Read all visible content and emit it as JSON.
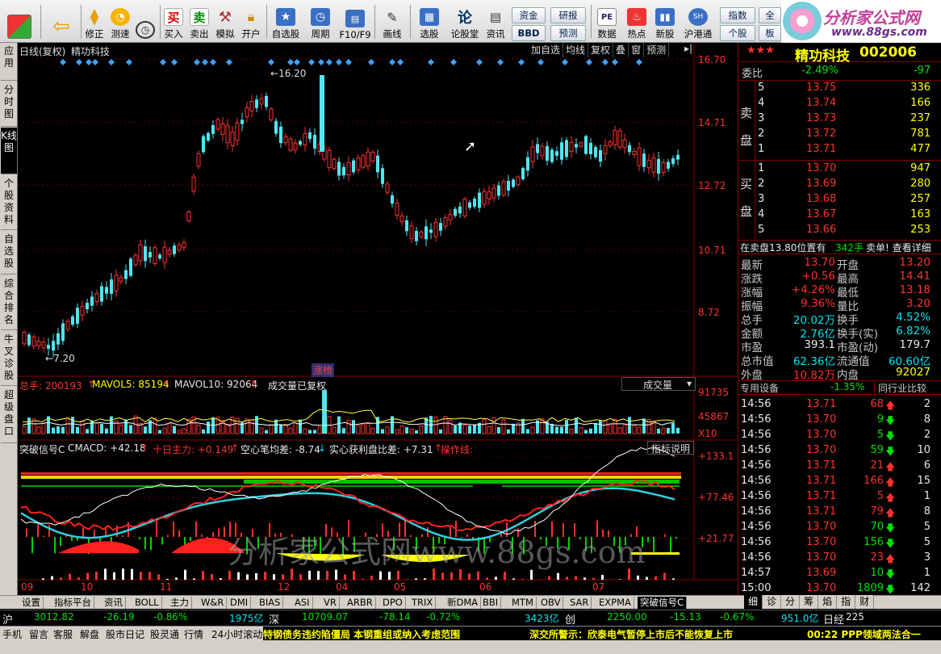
{
  "toolbar": {
    "buttons": [
      {
        "label": "修正",
        "icon": "up-down-arrow-icon"
      },
      {
        "label": "测速",
        "icon": "speed-icon"
      },
      {
        "label": "",
        "icon": "clock-icon"
      },
      {
        "label": "买入",
        "icon": "buy-icon",
        "glyph": "买"
      },
      {
        "label": "卖出",
        "icon": "sell-icon",
        "glyph": "卖"
      },
      {
        "label": "模拟",
        "icon": "hammer-icon"
      },
      {
        "label": "开户",
        "icon": "lock-icon"
      },
      {
        "label": "自选股",
        "icon": "star-icon"
      },
      {
        "label": "周期",
        "icon": "clock-cycle-icon"
      },
      {
        "label": "F10/F9",
        "icon": "f10-icon"
      },
      {
        "label": "画线",
        "icon": "pen-icon"
      },
      {
        "label": "选股",
        "icon": "select-stock-icon"
      },
      {
        "label": "论股堂",
        "icon": "forum-icon",
        "glyph": "论"
      },
      {
        "label": "资讯",
        "icon": "news-icon"
      },
      {
        "label": "数据",
        "icon": "pe-icon",
        "glyph": "PE"
      },
      {
        "label": "热点",
        "icon": "hot-icon"
      },
      {
        "label": "新股",
        "icon": "new-stock-icon"
      },
      {
        "label": "沪港通",
        "icon": "shhk-icon"
      }
    ],
    "small": [
      "资金",
      "BBD",
      "研报",
      "预测",
      "指数",
      "个股",
      "全",
      "板"
    ]
  },
  "logo": {
    "text": "分析家公式网",
    "url": "www.88gs.com"
  },
  "left_tabs": [
    "应用",
    "分时图",
    "K线图",
    "个股资料",
    "自选股",
    "综合排名",
    "牛叉诊股",
    "超级盘口"
  ],
  "chart": {
    "title_left": "日线(复权)",
    "stock_name": "精功科技",
    "top_buttons": [
      "加自选",
      "均线",
      "复权",
      "叠",
      "窗",
      "预测"
    ],
    "price_axis": [
      "16.70",
      "14.71",
      "12.72",
      "10.71",
      "8.72"
    ],
    "high_label": "16.20",
    "low_label": "7.20",
    "zhangbang": "涨榜",
    "vol_header": {
      "total": "总手: 200193",
      "ma5": "MAVOL5: 85194",
      "ma10": "MAVOL10: 92064",
      "note": "成交量已复权",
      "sel": "成交量"
    },
    "vol_axis": [
      "91735",
      "45867",
      "X10"
    ],
    "ind_header": {
      "name": "突破信号C",
      "cmacd": "CMACD: +42.18",
      "sd": "十日主力: +0.149",
      "kx": "空心笔均差: -8.74",
      "sx": "实心获利盘比差: +7.31",
      "cz": "操作线:",
      "btn": "指标说明"
    },
    "ind_axis": [
      "+133.1",
      "+77.46",
      "+21.77"
    ],
    "months": [
      "09",
      "10",
      "11",
      "12",
      "04",
      "05",
      "06",
      "07"
    ],
    "watermark": "分析家公式网www.88gs.com"
  },
  "quote": {
    "stars": "★★★",
    "name": "精功科技",
    "code": "002006",
    "weibi_label": "委比",
    "weibi": "-2.49%",
    "weicha": "-97",
    "sell_label": [
      "卖",
      "盘"
    ],
    "buy_label": [
      "买",
      "盘"
    ],
    "sells": [
      [
        "5",
        "13.75",
        "336"
      ],
      [
        "4",
        "13.74",
        "166"
      ],
      [
        "3",
        "13.73",
        "237"
      ],
      [
        "2",
        "13.72",
        "781"
      ],
      [
        "1",
        "13.71",
        "477"
      ]
    ],
    "buys": [
      [
        "1",
        "13.70",
        "947"
      ],
      [
        "2",
        "13.69",
        "280"
      ],
      [
        "3",
        "13.68",
        "257"
      ],
      [
        "4",
        "13.67",
        "163"
      ],
      [
        "5",
        "13.66",
        "253"
      ]
    ],
    "info": "在卖盘13.80位置有",
    "info_qty": "342手",
    "info_tail": "卖单! 查看详细",
    "stats": [
      [
        "最新",
        "13.70",
        "开盘",
        "13.20"
      ],
      [
        "涨跌",
        "+0.56",
        "最高",
        "14.41"
      ],
      [
        "涨幅",
        "+4.26%",
        "最低",
        "13.18"
      ],
      [
        "振幅",
        "9.36%",
        "量比",
        "3.20"
      ],
      [
        "总手",
        "20.02万",
        "换手",
        "4.52%"
      ],
      [
        "金额",
        "2.76亿",
        "换手(实)",
        "6.82%"
      ],
      [
        "市盈",
        "393.1",
        "市盈(动)",
        "179.7"
      ],
      [
        "总市值",
        "62.36亿",
        "流通值",
        "60.60亿"
      ],
      [
        "外盘",
        "10.82万",
        "内盘",
        "92027"
      ]
    ],
    "sector": "专用设备",
    "sector_pct": "-1.35%",
    "compare": "同行业比较",
    "ticks": [
      [
        "14:56",
        "13.71",
        "68",
        "up",
        "2"
      ],
      [
        "14:56",
        "13.70",
        "9",
        "down",
        "8"
      ],
      [
        "14:56",
        "13.70",
        "5",
        "down",
        "2"
      ],
      [
        "14:56",
        "13.70",
        "59",
        "down",
        "10"
      ],
      [
        "14:56",
        "13.71",
        "21",
        "up",
        "6"
      ],
      [
        "14:56",
        "13.71",
        "166",
        "up",
        "15"
      ],
      [
        "14:56",
        "13.71",
        "5",
        "up",
        "1"
      ],
      [
        "14:56",
        "13.71",
        "79",
        "up",
        "8"
      ],
      [
        "14:56",
        "13.70",
        "70",
        "down",
        "5"
      ],
      [
        "14:56",
        "13.70",
        "156",
        "down",
        "5"
      ],
      [
        "14:56",
        "13.70",
        "23",
        "up",
        "3"
      ],
      [
        "14:57",
        "13.69",
        "10",
        "down",
        "1"
      ],
      [
        "15:00",
        "13.70",
        "1809",
        "down",
        "142"
      ]
    ],
    "side_tabs": [
      "细",
      "诊",
      "分",
      "筹",
      "焰",
      "指",
      "财"
    ]
  },
  "bottom_tabs": [
    "设置",
    "指标平台",
    "资讯",
    "BOLL",
    "主力",
    "W&R",
    "DMI",
    "BIAS",
    "ASI",
    "VR",
    "ARBR",
    "DPO",
    "TRIX",
    "新DMA",
    "BBI",
    "MTM",
    "OBV",
    "SAR",
    "EXPMA",
    "突破信号C"
  ],
  "status1": {
    "sh_label": "沪",
    "sh": "3012.82",
    "sh_chg": "-26.19",
    "sh_pct": "-0.86%",
    "sh_amt": "1975亿",
    "sz_label": "深",
    "sz": "10709.07",
    "sz_chg": "-78.14",
    "sz_pct": "-0.72%",
    "sz_amt": "3423亿",
    "cy_label": "创",
    "cy": "2250.00",
    "cy_chg": "-15.13",
    "cy_pct": "-0.67%",
    "cy_amt": "951.0亿",
    "rj_label": "日经",
    "rj": "225"
  },
  "status2": {
    "items": [
      "手机",
      "留言",
      "客服",
      "解盘",
      "股市日记",
      "股灵通",
      "行情",
      "24小时滚动"
    ],
    "news1": "特钢债务违约陷僵局 本钢重组或纳入考虑范围",
    "news2": "深交所警示：欣泰电气暂停上市后不能恢复上市",
    "news3": "00:22 PPP领域两法合一"
  }
}
